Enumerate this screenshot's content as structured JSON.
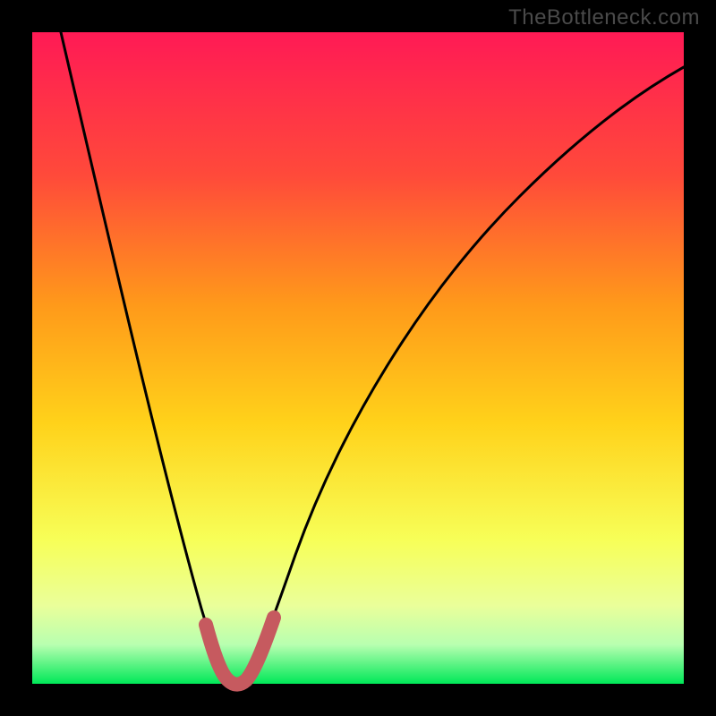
{
  "watermark": "TheBottleneck.com",
  "colors": {
    "bg": "#000000",
    "grad_top": "#ff1a55",
    "grad_upper_mid": "#ff6a2a",
    "grad_mid": "#ffd21a",
    "grad_lower_mid": "#f7ff66",
    "grad_low": "#d9ffb0",
    "grad_bottom": "#00e858",
    "curve": "#000000",
    "valley": "#c65a5f"
  },
  "chart_data": {
    "type": "line",
    "title": "",
    "xlabel": "",
    "ylabel": "",
    "xlim": [
      0,
      100
    ],
    "ylim": [
      0,
      100
    ],
    "series": [
      {
        "name": "black-curve",
        "x": [
          5,
          10,
          15,
          20,
          25,
          27,
          28,
          29,
          30,
          31,
          32,
          33,
          35,
          40,
          45,
          50,
          55,
          60,
          65,
          70,
          75,
          80,
          85,
          90,
          95,
          100
        ],
        "y": [
          100,
          80,
          60,
          40,
          20,
          10,
          6,
          3,
          1,
          0.5,
          1,
          3,
          8,
          20,
          32,
          42,
          51,
          58,
          64,
          69,
          73,
          76,
          78,
          80,
          81.5,
          83
        ]
      },
      {
        "name": "valley-highlight",
        "x": [
          27,
          28,
          29,
          30,
          31,
          32,
          33,
          34
        ],
        "y": [
          10,
          6,
          3,
          1,
          0.5,
          1,
          3,
          6
        ]
      }
    ],
    "annotations": [
      {
        "text": "TheBottleneck.com",
        "position": "top-right"
      }
    ]
  }
}
